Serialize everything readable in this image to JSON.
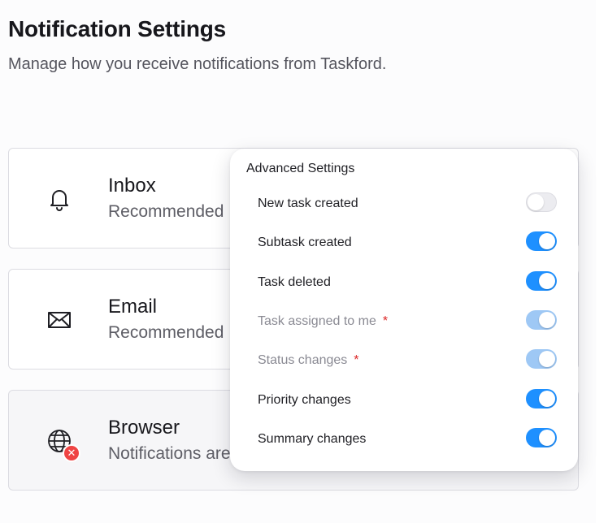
{
  "header": {
    "title": "Notification Settings",
    "subtitle": "Manage how you receive notifications from Taskford."
  },
  "channels": [
    {
      "title": "Inbox",
      "subtitle": "Recommended",
      "icon": "bell-icon"
    },
    {
      "title": "Email",
      "subtitle": "Recommended",
      "icon": "envelope-icon"
    },
    {
      "title": "Browser",
      "subtitle": "Notifications are",
      "icon": "globe-icon",
      "status": "error"
    }
  ],
  "advanced": {
    "title": "Advanced Settings",
    "items": [
      {
        "label": "New task created",
        "enabled": false,
        "locked": false
      },
      {
        "label": "Subtask created",
        "enabled": true,
        "locked": false
      },
      {
        "label": "Task deleted",
        "enabled": true,
        "locked": false
      },
      {
        "label": "Task assigned to me",
        "required": "*",
        "enabled": true,
        "locked": true
      },
      {
        "label": "Status changes",
        "required": "*",
        "enabled": true,
        "locked": true
      },
      {
        "label": "Priority changes",
        "enabled": true,
        "locked": false
      },
      {
        "label": "Summary changes",
        "enabled": true,
        "locked": false
      }
    ]
  },
  "colors": {
    "toggle_on": "#1e90ff",
    "toggle_locked": "#9ec8f5",
    "toggle_off": "#ececf0",
    "required": "#dc2626",
    "error_badge": "#ef4444"
  }
}
